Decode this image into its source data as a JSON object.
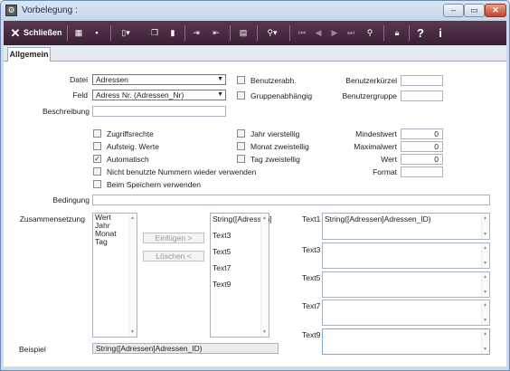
{
  "window": {
    "title": "Vorbelegung :"
  },
  "toolbar": {
    "close_label": "Schließen"
  },
  "tabs": [
    "Allgemein"
  ],
  "form": {
    "datei_label": "Datei",
    "datei_value": "Adressen",
    "feld_label": "Feld",
    "feld_value": "Adress Nr. (Adressen_Nr)",
    "beschreibung_label": "Beschreibung",
    "benutzerabh_label": "Benutzerabh.",
    "gruppenabh_label": "Gruppenabhängig",
    "benutzerkuerzel_label": "Benutzerkürzel",
    "benutzergruppe_label": "Benutzergruppe",
    "zugriffsrechte_label": "Zugriffsrechte",
    "aufsteig_label": "Aufsteig. Werte",
    "automatisch_label": "Automatisch",
    "nicht_benutzte_label": "Nicht benutzte Nummern wieder verwenden",
    "beim_speichern_label": "Beim Speichern verwenden",
    "jahr_label": "Jahr vierstellig",
    "monat_label": "Monat zweistellig",
    "tag_label": "Tag zweistellig",
    "mindestwert_label": "Mindestwert",
    "mindestwert_value": "0",
    "maximalwert_label": "Maximalwert",
    "maximalwert_value": "0",
    "wert_label": "Wert",
    "wert_value": "0",
    "format_label": "Format",
    "bedingung_label": "Bedingung",
    "zusammensetzung_label": "Zusammensetzung",
    "available_items": [
      "Wert",
      "Jahr",
      "Monat",
      "Tag"
    ],
    "einfuegen_label": "Einfügen >",
    "loeschen_label": "Löschen <",
    "selected_items": [
      "String([Adressen]",
      "Text3",
      "Text5",
      "Text7",
      "Text9"
    ],
    "text1_label": "Text1",
    "text1_value": "String([Adressen]Adressen_ID)",
    "text3_label": "Text3",
    "text5_label": "Text5",
    "text7_label": "Text7",
    "text9_label": "Text9",
    "beispiel_label": "Beispiel",
    "beispiel_value": "String([Adressen]Adressen_ID)"
  }
}
